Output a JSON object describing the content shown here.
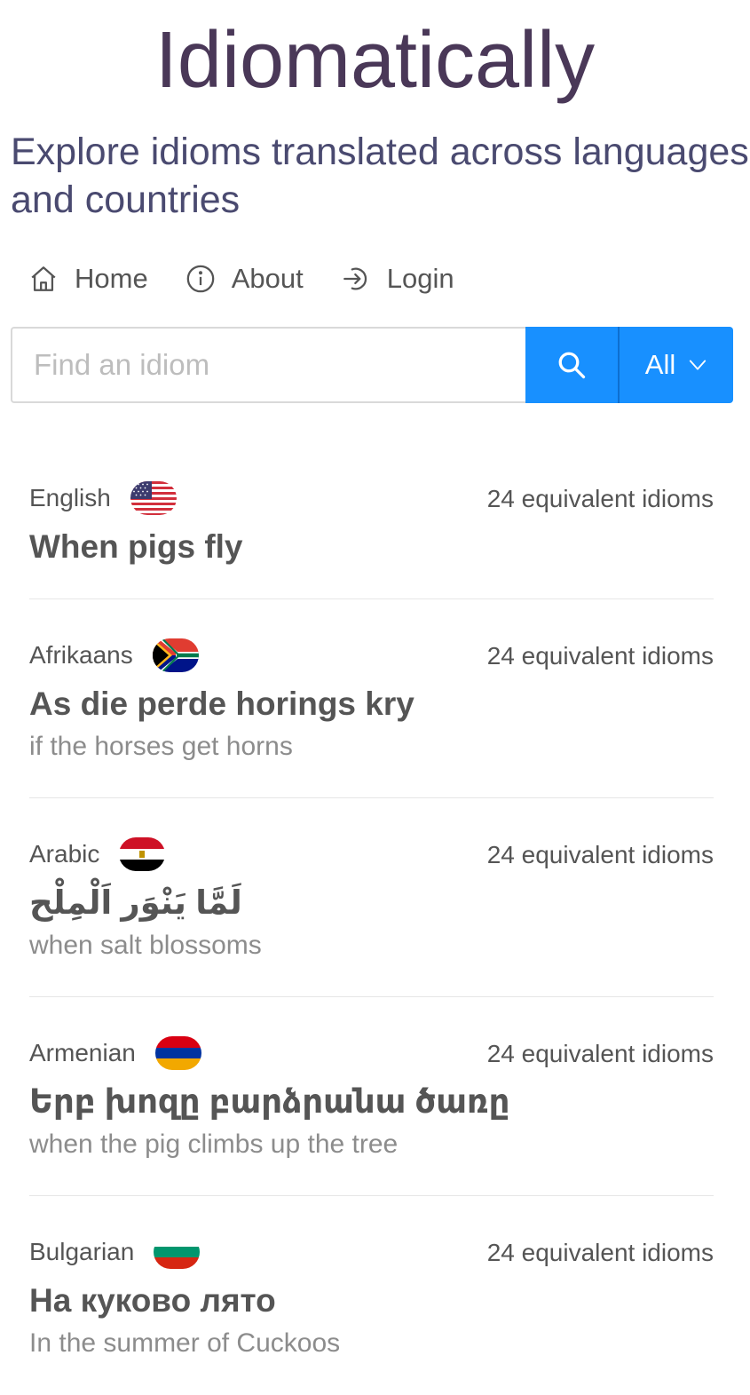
{
  "header": {
    "title": "Idiomatically",
    "tagline": "Explore idioms translated across languages and countries"
  },
  "nav": {
    "items": [
      {
        "label": "Home",
        "icon": "home-icon"
      },
      {
        "label": "About",
        "icon": "info-icon"
      },
      {
        "label": "Login",
        "icon": "login-icon"
      }
    ]
  },
  "search": {
    "placeholder": "Find an idiom",
    "value": "",
    "filter_value": "All",
    "accent_color": "#1890ff"
  },
  "idioms": [
    {
      "language": "English",
      "flag": "us-flag-icon",
      "count": "24 equivalent idioms",
      "idiom": "When pigs fly",
      "translation": ""
    },
    {
      "language": "Afrikaans",
      "flag": "south-africa-flag-icon",
      "count": "24 equivalent idioms",
      "idiom": "As die perde horings kry",
      "translation": "if the horses get horns"
    },
    {
      "language": "Arabic",
      "flag": "egypt-flag-icon",
      "count": "24 equivalent idioms",
      "idiom": "لَمَّا يَنْوَر اَلْمِلْح",
      "translation": "when salt blossoms"
    },
    {
      "language": "Armenian",
      "flag": "armenia-flag-icon",
      "count": "24 equivalent idioms",
      "idiom": "Երբ խոզը բարձրանա ծառը",
      "translation": "when the pig climbs up the tree"
    },
    {
      "language": "Bulgarian",
      "flag": "bulgaria-flag-icon",
      "count": "24 equivalent idioms",
      "idiom": "На куково лято",
      "translation": "In the summer of Cuckoos"
    }
  ]
}
